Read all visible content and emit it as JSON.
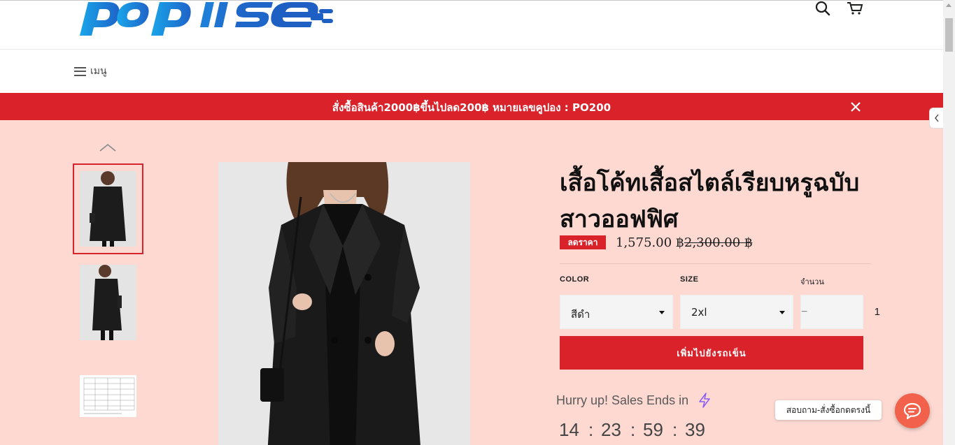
{
  "header": {
    "logo_alt": "popular store logo",
    "search_icon": "search-icon",
    "cart_icon": "cart-icon"
  },
  "nav": {
    "menu_label": "เมนู",
    "menu_icon": "hamburger-icon"
  },
  "announcement": {
    "text": "สั่งซื้อสินค้า2000฿ขึ้นไปลด200฿ หมายเลขคูปอง : PO200",
    "close_icon": "close-icon",
    "color": "#d9222a"
  },
  "product": {
    "title": "เสื้อโค้ทเสื้อสไตล์เรียบหรูฉบับสาวออฟฟิศ",
    "sale_badge": "ลดราคา",
    "price": "1,575.00 ฿",
    "compare_price": "2,300.00 ฿",
    "options": {
      "color_label": "COLOR",
      "color_value": "สีดำ",
      "size_label": "SIZE",
      "size_value": "2xl",
      "qty_label": "จำนวน",
      "qty_value": "1",
      "qty_minus": "−",
      "qty_plus": "+"
    },
    "add_to_cart": "เพิ่มไปยังรถเข็น",
    "accent_color": "#d9222a",
    "background_color": "#fdd9d2"
  },
  "countdown": {
    "label": "Hurry up! Sales Ends in",
    "icon": "lightning-icon",
    "hours": "14",
    "minutes": "23",
    "seconds": "59",
    "centis": "39",
    "sep": ":"
  },
  "chat": {
    "label": "สอบถาม-สั่งซื้อกดตรงนี้",
    "icon": "chat-bubble-icon",
    "color": "#f2614b"
  }
}
